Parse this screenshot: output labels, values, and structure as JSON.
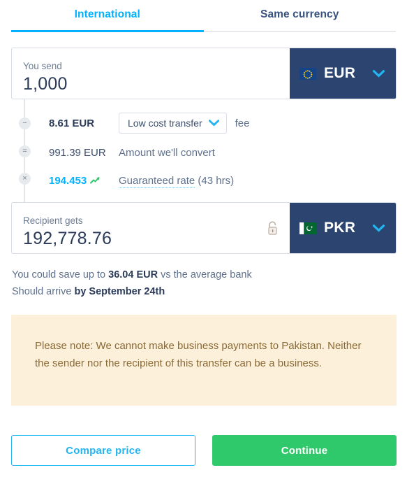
{
  "tabs": [
    {
      "label": "International",
      "active": true
    },
    {
      "label": "Same currency",
      "active": false
    }
  ],
  "send": {
    "label": "You send",
    "amount": "1,000",
    "currency_code": "EUR",
    "flag": "eu-flag-icon",
    "chevron": "chevron-down-icon"
  },
  "breakdown": {
    "fee": {
      "operator": "−",
      "amount": "8.61 EUR",
      "select_label": "Low cost transfer",
      "suffix": "fee"
    },
    "convert": {
      "operator": "=",
      "amount": "991.39 EUR",
      "description": "Amount we'll convert"
    },
    "rate": {
      "operator": "×",
      "amount": "194.453",
      "trend_icon": "trend-up-icon",
      "link_text": "Guaranteed rate",
      "duration": "(43 hrs)"
    }
  },
  "receive": {
    "label": "Recipient gets",
    "amount": "192,778.76",
    "currency_code": "PKR",
    "flag": "pakistan-flag-icon",
    "lock_icon": "unlocked-padlock-icon",
    "chevron": "chevron-down-icon"
  },
  "info": {
    "save_prefix": "You could save up to ",
    "save_amount": "36.04 EUR",
    "save_suffix": " vs the average bank",
    "arrive_prefix": "Should arrive ",
    "arrive_date": "by September 24th"
  },
  "note": {
    "text": "Please note: We cannot make business payments to Pakistan. Neither the sender nor the recipient of this transfer can be a business."
  },
  "buttons": {
    "compare": "Compare price",
    "continue": "Continue"
  },
  "colors": {
    "accent_blue": "#00b2ff",
    "navy": "#2b4570",
    "green": "#2fc96b",
    "note_bg": "#fdf0da",
    "note_text": "#8a6a36"
  }
}
